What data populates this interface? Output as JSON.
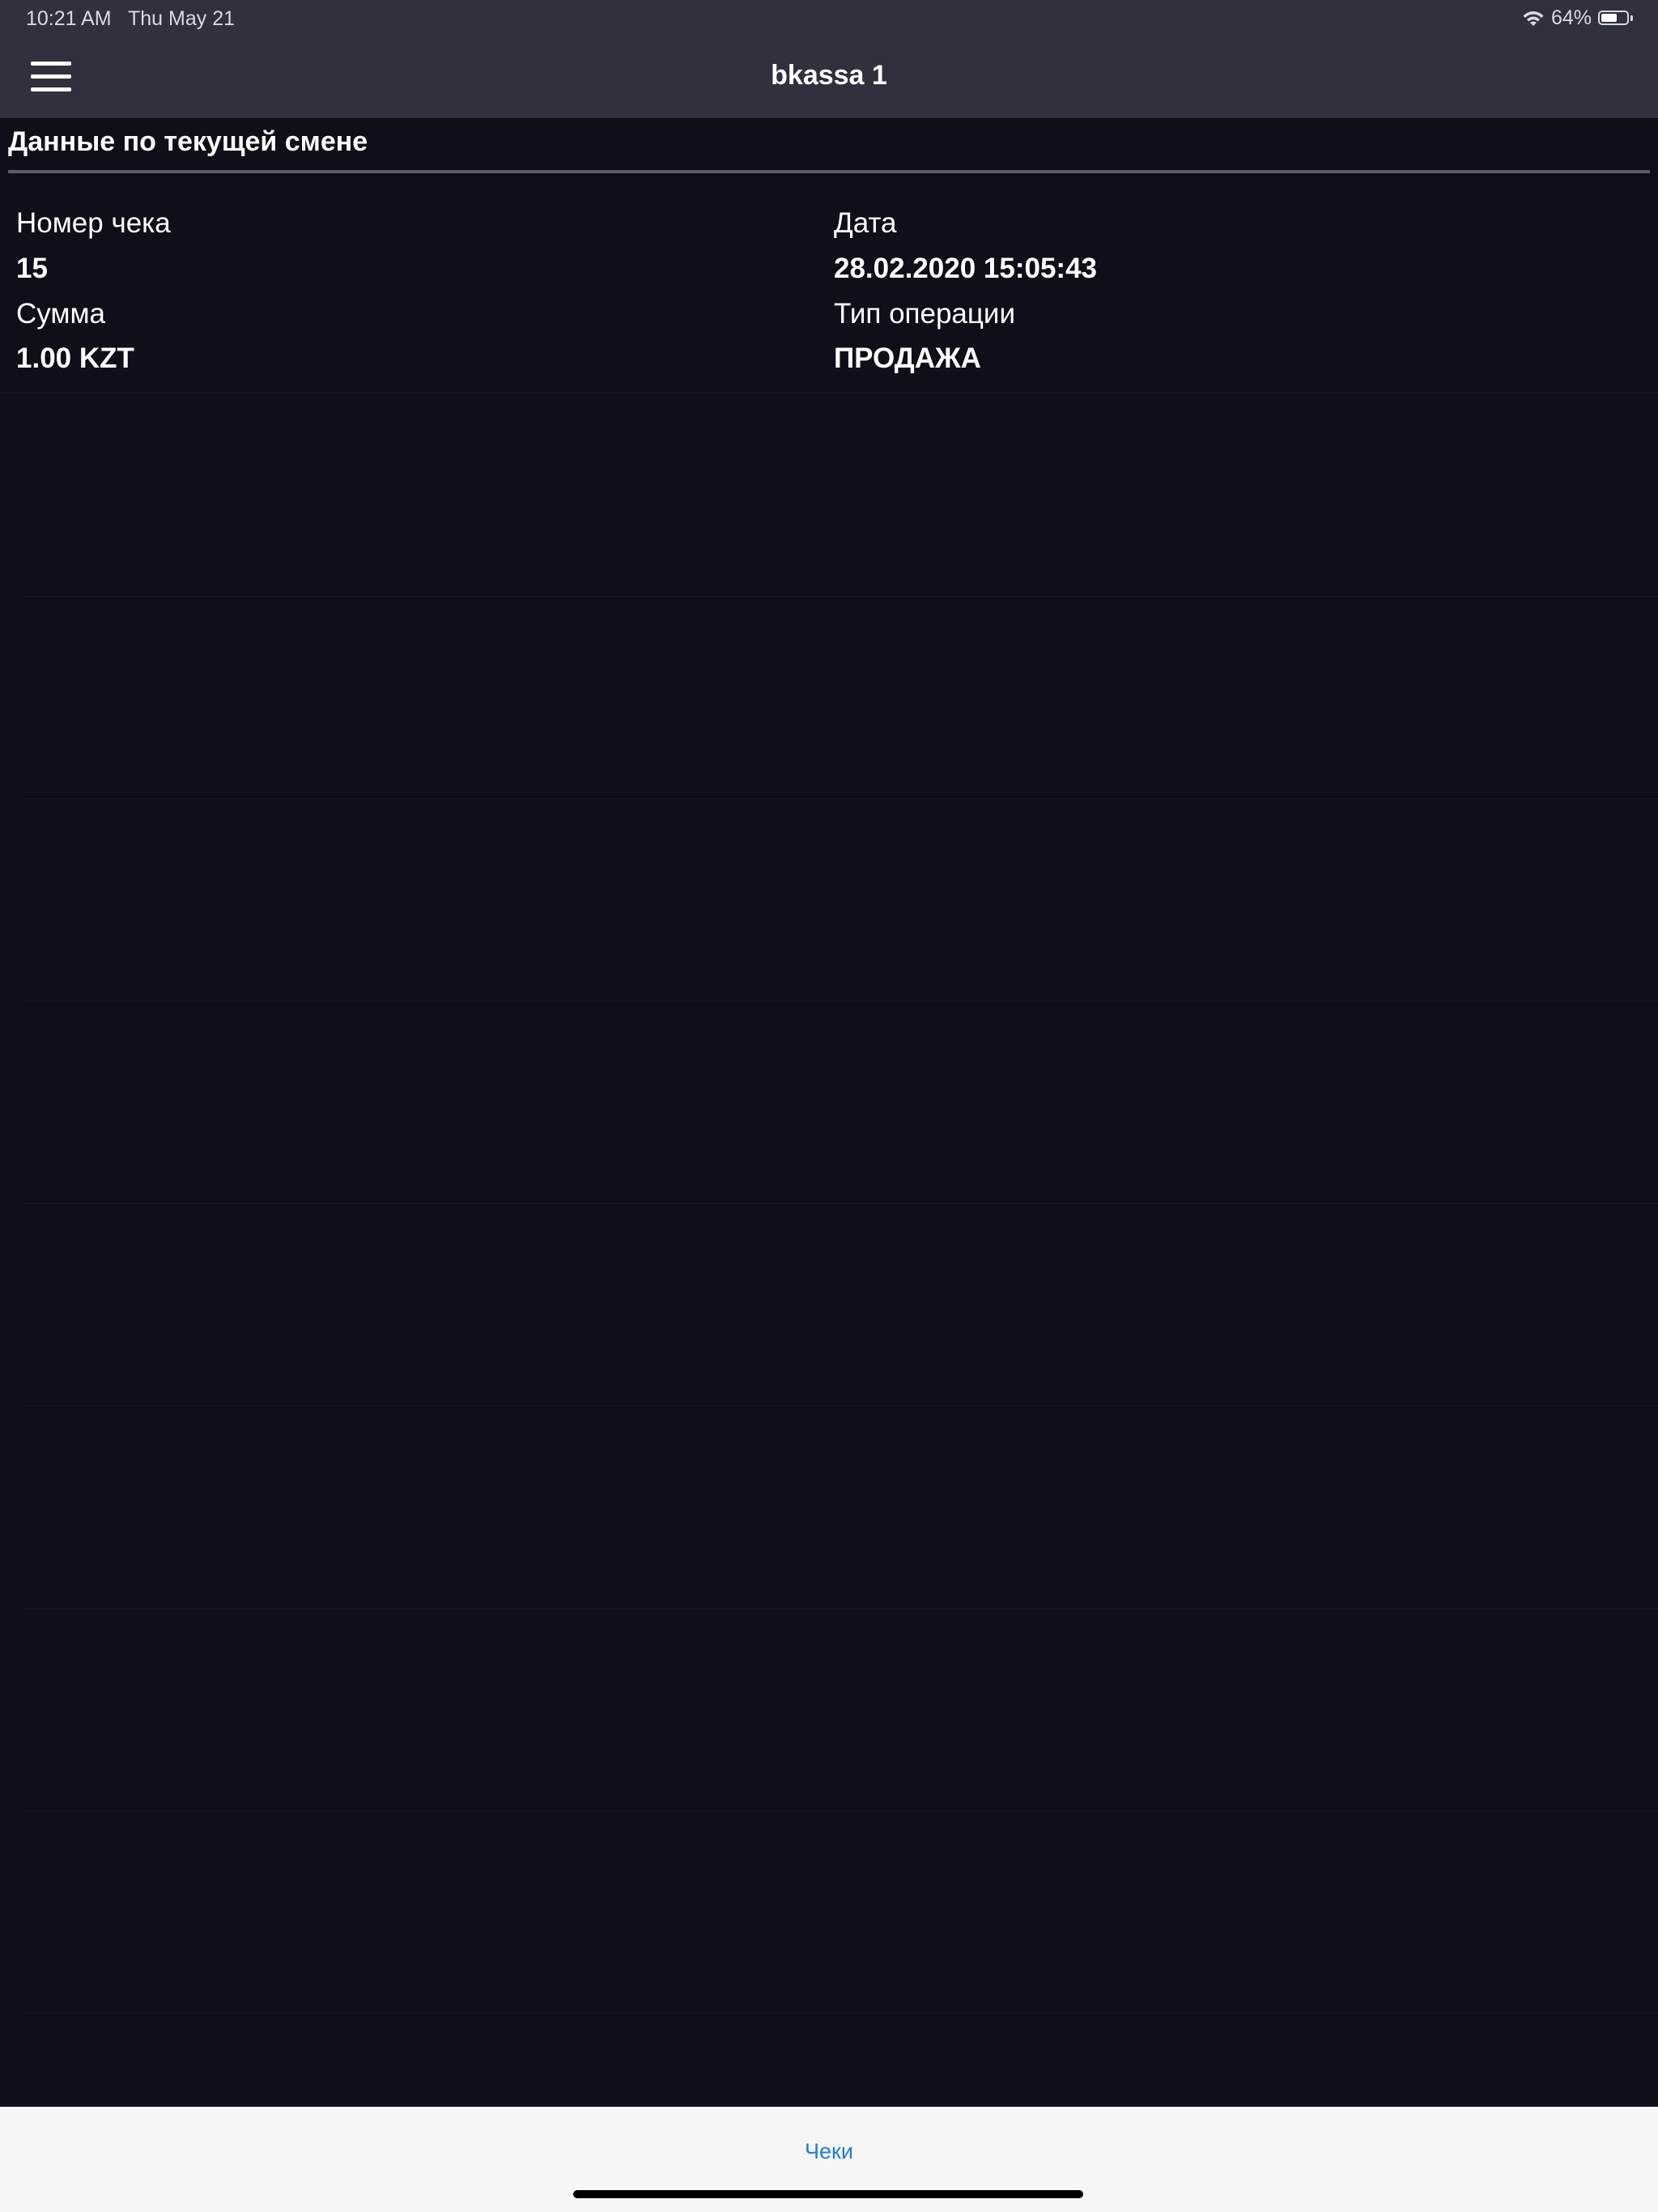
{
  "status_bar": {
    "time": "10:21 AM",
    "date": "Thu May 21",
    "battery_text": "64%",
    "battery_level": 0.64,
    "wifi_icon": "wifi-icon",
    "battery_icon": "battery-icon"
  },
  "nav": {
    "title": "bkassa 1",
    "menu_icon": "hamburger-menu-icon"
  },
  "section": {
    "title": "Данные по текущей смене"
  },
  "receipt": {
    "number_label": "Номер чека",
    "number_value": "15",
    "date_label": "Дата",
    "date_value": "28.02.2020 15:05:43",
    "sum_label": "Сумма",
    "sum_value": "1.00 KZT",
    "op_label": "Тип операции",
    "op_value": "ПРОДАЖА"
  },
  "tab_bar": {
    "items": [
      {
        "label": "Чеки"
      }
    ]
  },
  "colors": {
    "background": "#0e0f19",
    "topbar": "#2f313e",
    "tab_bar": "#f6f6f6",
    "accent": "#1a7ee0"
  }
}
